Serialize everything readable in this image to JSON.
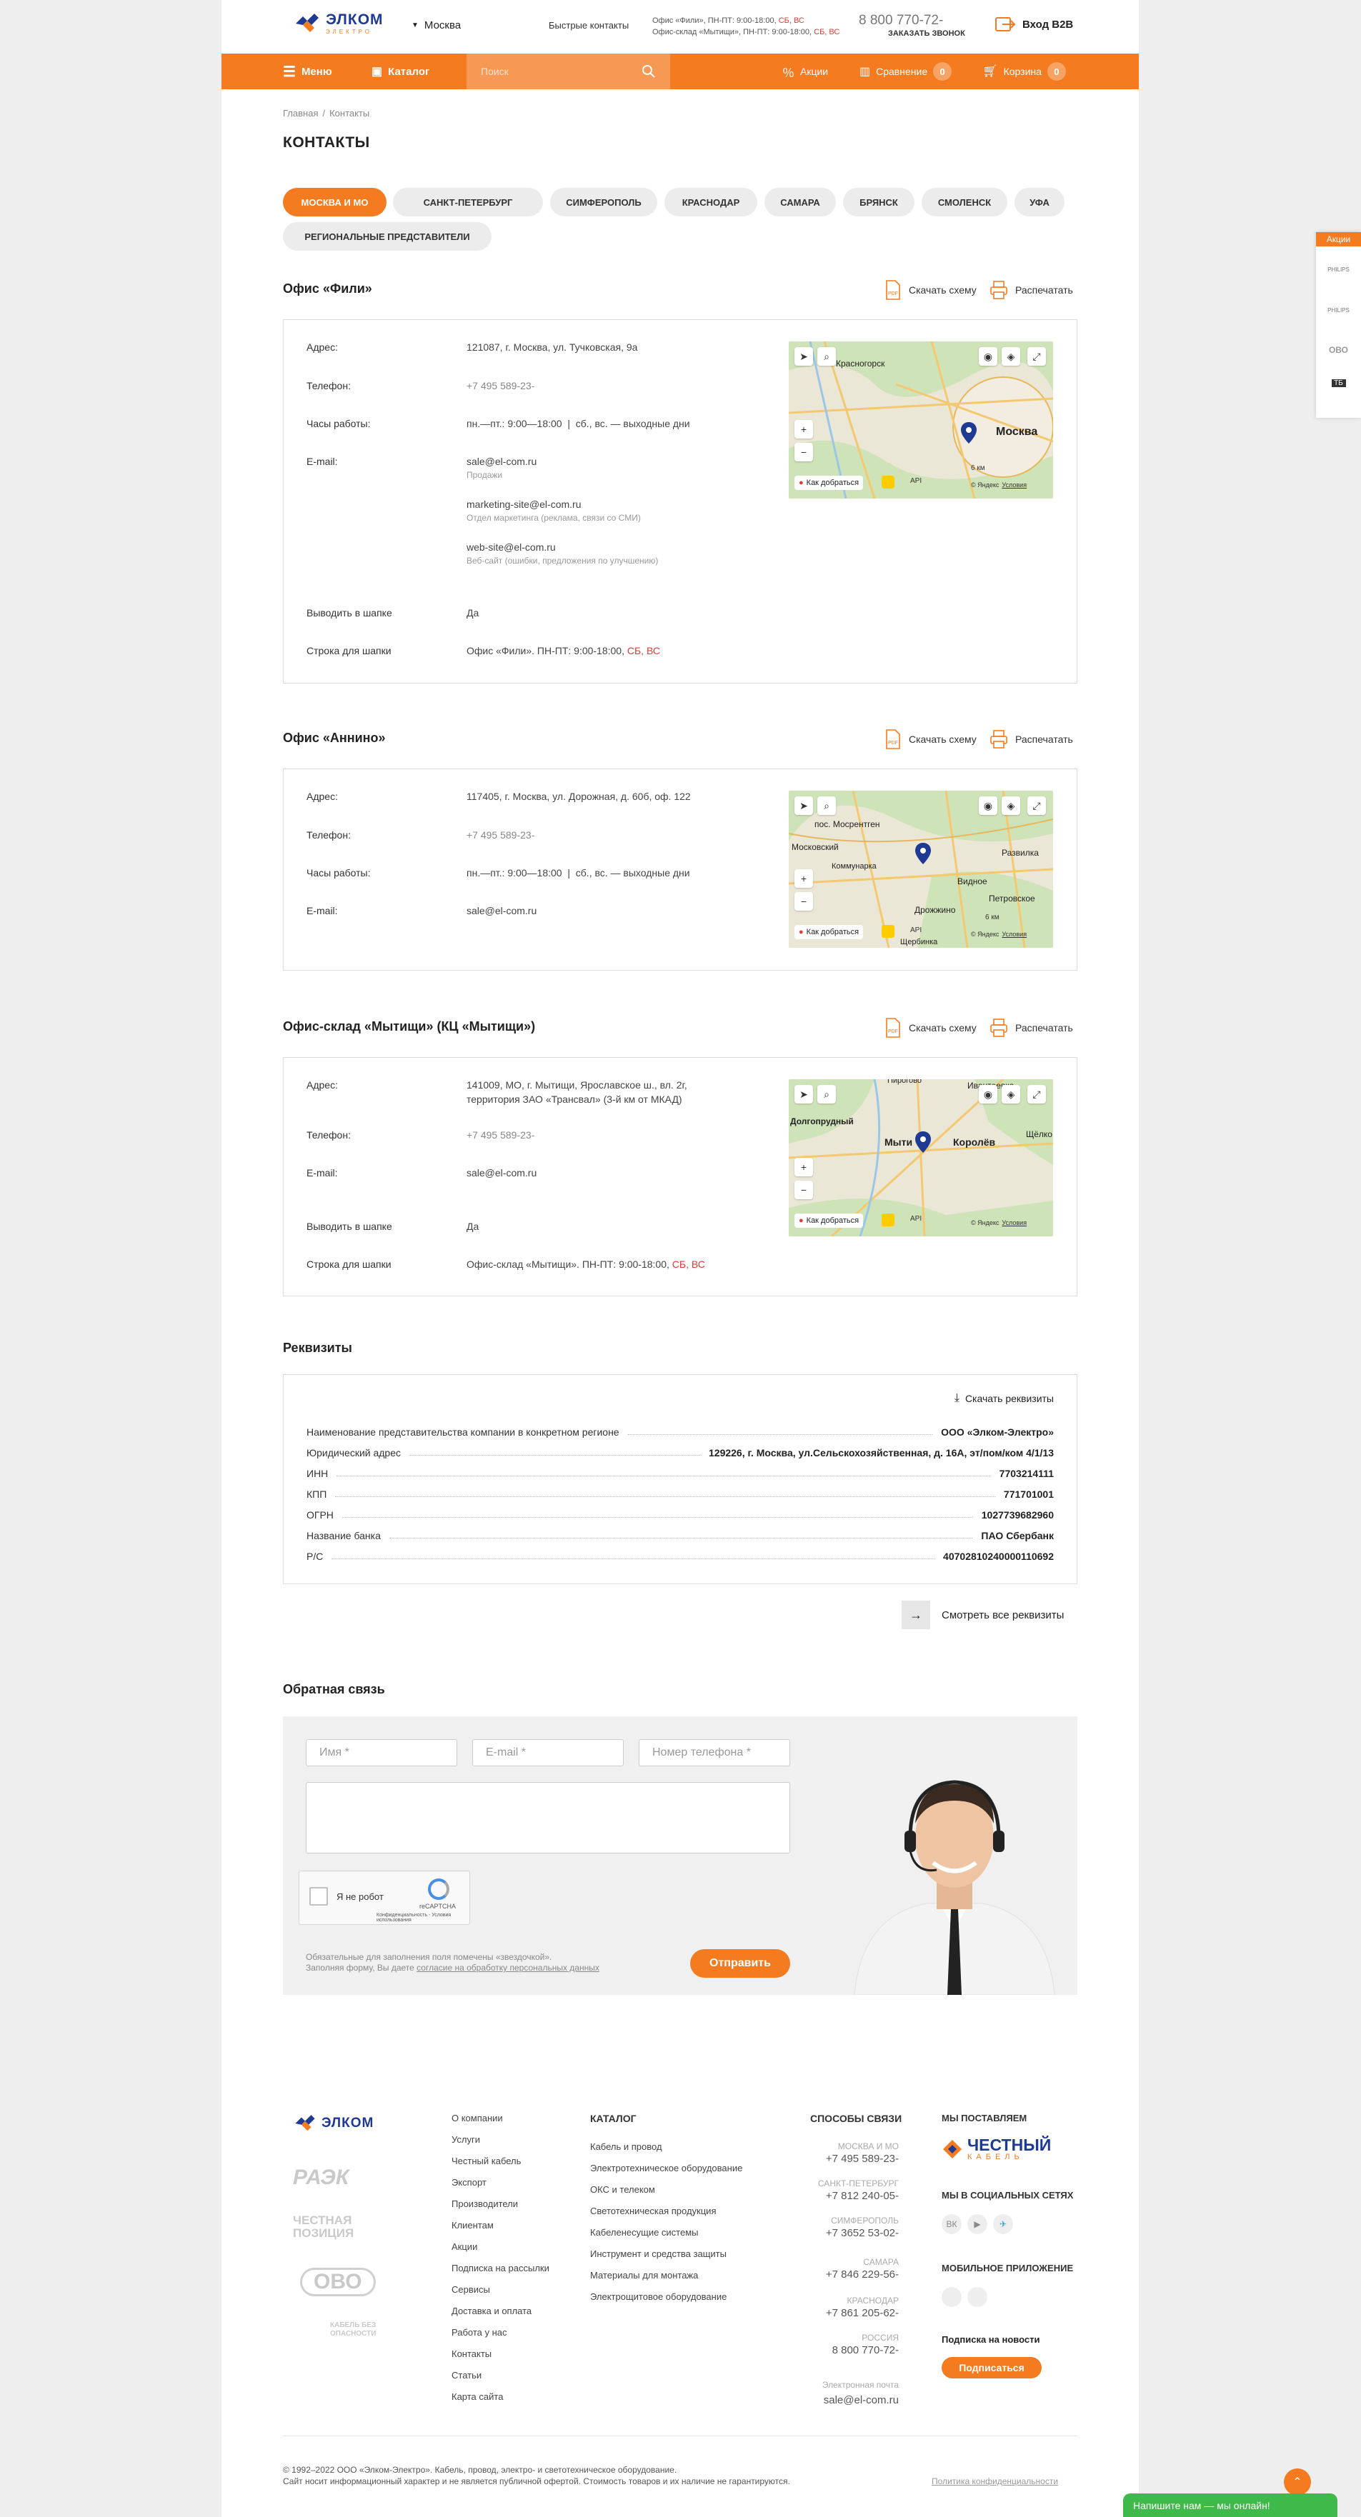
{
  "header": {
    "logo": "ЭЛКОМ",
    "logo_sub": "ЭЛЕКТРО",
    "city": "Москва",
    "quick_contacts": "Быстрые контакты",
    "office1_prefix": "Офис «Фили», ПН-ПТ: 9:00-18:00, ",
    "office2_prefix": "Офис-склад «Мытищи», ПН-ПТ: 9:00-18:00, ",
    "weekend": "СБ, ВС",
    "phone": "8 800 770-72-",
    "callback": "ЗАКАЗАТЬ ЗВОНОК",
    "b2b": "Вход B2B"
  },
  "nav": {
    "menu": "Меню",
    "catalog": "Каталог",
    "search_placeholder": "Поиск",
    "promos": "Акции",
    "compare": "Сравнение",
    "compare_count": "0",
    "cart": "Корзина",
    "cart_count": "0"
  },
  "breadcrumb": {
    "home": "Главная",
    "sep": "/",
    "current": "Контакты"
  },
  "page_title": "КОНТАКТЫ",
  "cities": [
    "Москва и МО",
    "Санкт-Петербург",
    "Симферополь",
    "Краснодар",
    "Самара",
    "Брянск",
    "Смоленск",
    "Уфа",
    "Региональные представители"
  ],
  "actions": {
    "download": "Скачать схему",
    "print": "Распечатать"
  },
  "labels": {
    "address": "Адрес:",
    "phone": "Телефон:",
    "hours": "Часы работы:",
    "email": "E-mail:",
    "show_header": "Выводить в шапке",
    "header_line": "Строка для шапки"
  },
  "offices": [
    {
      "title": "Офис «Фили»",
      "address": "121087, г. Москва, ул. Тучковская, 9а",
      "phone": "+7 495 589-23-",
      "hours": "пн.—пт.: 9:00—18:00  |  сб., вс. — выходные дни",
      "emails": [
        {
          "email": "sale@el-com.ru",
          "note": "Продажи"
        },
        {
          "email": "marketing-site@el-com.ru",
          "note": "Отдел маркетинга (реклама, связи со СМИ)"
        },
        {
          "email": "web-site@el-com.ru",
          "note": "Веб-сайт (ошибки, предложения по улучшению)"
        }
      ],
      "show_header": "Да",
      "header_line": "Офис «Фили». ПН-ПТ: 9:00-18:00, ",
      "map_city": "Москва",
      "map_town": "Красногорск"
    },
    {
      "title": "Офис «Аннино»",
      "address": "117405, г. Москва, ул. Дорожная, д. 60б, оф. 122",
      "phone": "+7 495 589-23-",
      "hours": "пн.—пт.: 9:00—18:00  |  сб., вс. — выходные дни",
      "email": "sale@el-com.ru",
      "map_labels": [
        "пос. Мосрентген",
        "Московский",
        "Коммунарка",
        "Развилка",
        "Видное",
        "Петровское",
        "Дрожжино",
        "Щербинка"
      ]
    },
    {
      "title": "Офис-склад «Мытищи» (КЦ «Мытищи»)",
      "address1": "141009, МО, г. Мытищи, Ярославское ш., вл. 2г,",
      "address2": "территория ЗАО «Трансвал» (3-й км от МКАД)",
      "phone": "+7 495 589-23-",
      "email": "sale@el-com.ru",
      "show_header": "Да",
      "header_line": "Офис-склад «Мытищи». ПН-ПТ: 9:00-18:00, ",
      "map_labels": [
        "Мыти",
        "Королёв",
        "Щёлко",
        "Ивантеевка",
        "Долгопрудный",
        "Пирогово"
      ]
    }
  ],
  "map_ui": {
    "route": "Как добраться",
    "yandex": "© Яндекс",
    "terms": "Условия",
    "scale": "6 км",
    "api": "АРІ"
  },
  "requisites": {
    "title": "Реквизиты",
    "download": "Скачать реквизиты",
    "rows": [
      {
        "label": "Наименование представительства компании в конкретном регионе",
        "value": "ООО «Элком-Электро»"
      },
      {
        "label": "Юридический адрес",
        "value": "129226, г. Москва, ул.Сельскохозяйственная, д. 16А, эт/пом/ком 4/1/13"
      },
      {
        "label": "ИНН",
        "value": "7703214111"
      },
      {
        "label": "КПП",
        "value": "771701001"
      },
      {
        "label": "ОГРН",
        "value": "1027739682960"
      },
      {
        "label": "Название банка",
        "value": "ПАО Сбербанк"
      },
      {
        "label": "Р/С",
        "value": "40702810240000110692"
      }
    ],
    "see_all": "Смотреть все реквизиты"
  },
  "feedback": {
    "title": "Обратная связь",
    "name": "Имя *",
    "email": "E-mail *",
    "phone": "Номер телефона *",
    "captcha": "Я не робот",
    "recaptcha": "reCAPTCHA",
    "recaptcha_links": "Конфиденциальность - Условия использования",
    "note1": "Обязательные для заполнения поля помечены «звездочкой».",
    "note2_prefix": "Заполняя форму, Вы даете ",
    "note2_link": "согласие на обработку персональных данных",
    "submit": "Отправить"
  },
  "footer": {
    "partner_logos": [
      "ЭЛКОМ",
      "РАЭК",
      "ЧЕСТНАЯ ПОЗИЦИЯ",
      "ОВО",
      "КАБЕЛЬ БЕЗ ОПАСНОСТИ"
    ],
    "links": [
      "О компании",
      "Услуги",
      "Честный кабель",
      "Экспорт",
      "Производители",
      "Клиентам",
      "Акции",
      "Подписка на рассылки",
      "Сервисы",
      "Доставка и оплата",
      "Работа у нас",
      "Контакты",
      "Статьи",
      "Карта сайта"
    ],
    "catalog_title": "КАТАЛОГ",
    "catalog": [
      "Кабель и провод",
      "Электротехническое оборудование",
      "ОКС и телеком",
      "Светотехническая продукция",
      "Кабеленесущие системы",
      "Инструмент и средства защиты",
      "Материалы для монтажа",
      "Электрощитовое оборудование"
    ],
    "contacts_title": "СПОСОБЫ СВЯЗИ",
    "contacts": [
      {
        "city": "МОСКВА И МО",
        "phone": "+7 495 589-23-"
      },
      {
        "city": "САНКТ-ПЕТЕРБУРГ",
        "phone": "+7 812 240-05-"
      },
      {
        "city": "СИМФЕРОПОЛЬ",
        "phone": "+7 3652 53-02-"
      },
      {
        "city": "САМАРА",
        "phone": "+7 846 229-56-"
      },
      {
        "city": "КРАСНОДАР",
        "phone": "+7 861 205-62-"
      },
      {
        "city": "РОССИЯ",
        "phone": "8 800 770-72-"
      }
    ],
    "email_label": "Электронная почта",
    "email": "sale@el-com.ru",
    "supply_title": "МЫ ПОСТАВЛЯЕМ",
    "honest_cable": "ЧЕСТНЫЙ",
    "honest_cable_sub": "КАБЕЛЬ",
    "social_title": "МЫ В СОЦИАЛЬНЫХ СЕТЯХ",
    "social": [
      "ВК",
      "▶",
      "✈"
    ],
    "app_title": "МОБИЛЬНОЕ ПРИЛОЖЕНИЕ",
    "news_title": "Подписка на новости",
    "subscribe": "Подписаться",
    "copyright": "© 1992–2022 ООО «Элком-Электро». Кабель, провод, электро- и светотехническое оборудование.",
    "disclaimer": "Сайт носит информационный характер и не является публичной офертой. Стоимость товаров и их наличие не гарантируются.",
    "privacy": "Политика конфиденциальности"
  },
  "side": {
    "promos": "Акции",
    "brands": [
      "PHILIPS",
      "PHILIPS",
      "ОВО",
      "ТБ"
    ]
  },
  "chat": "Напишите нам — мы онлайн!"
}
